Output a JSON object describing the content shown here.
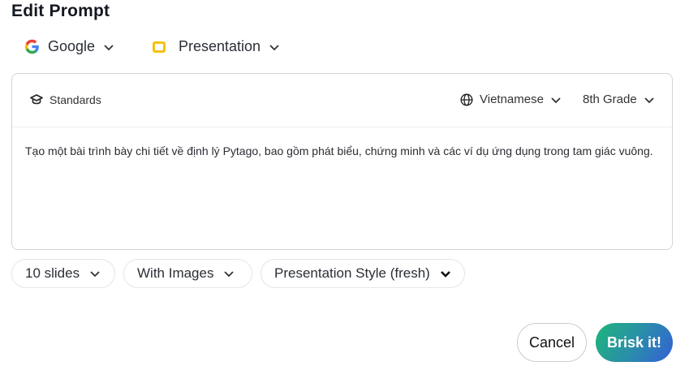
{
  "header": {
    "title": "Edit Prompt"
  },
  "source": {
    "provider": "Google",
    "format": "Presentation"
  },
  "card": {
    "standards_label": "Standards",
    "language": "Vietnamese",
    "grade": "8th Grade",
    "prompt_text": "Tạo một bài trình bày chi tiết về định lý Pytago, bao gồm phát biểu, chứng minh và các ví dụ ứng dụng trong tam giác vuông."
  },
  "options": {
    "slides": "10 slides",
    "images": "With Images",
    "style": "Presentation Style (fresh)"
  },
  "actions": {
    "cancel": "Cancel",
    "submit": "Brisk it!"
  },
  "colors": {
    "accent_start": "#1db57a",
    "accent_end": "#3460d6",
    "slides_icon": "#f4c20d"
  }
}
